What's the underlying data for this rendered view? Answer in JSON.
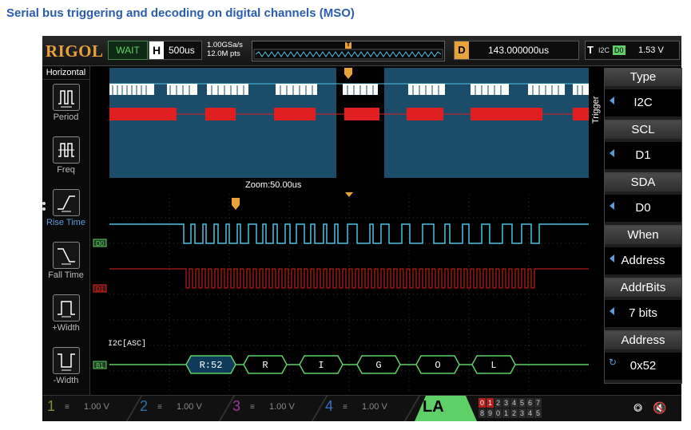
{
  "page": {
    "title": "Serial bus triggering and decoding on digital channels (MSO)"
  },
  "topbar": {
    "logo": "RIGOL",
    "status": "WAIT",
    "horizontal": {
      "key": "H",
      "value": "500us"
    },
    "sample_rate": "1.00GSa/s",
    "memory_depth": "12.0M pts",
    "trigger_marker": "T",
    "delay": {
      "key": "D",
      "value": "143.000000us"
    },
    "trigger": {
      "key": "T",
      "type": "I2C",
      "source": "D0",
      "level": "1.53 V"
    }
  },
  "leftbar": {
    "title": "Horizontal",
    "items": [
      {
        "label": "Period",
        "icon": "period-icon"
      },
      {
        "label": "Freq",
        "icon": "frequency-icon"
      },
      {
        "label": "Rise Time",
        "icon": "rise-time-icon"
      },
      {
        "label": "Fall Time",
        "icon": "fall-time-icon"
      },
      {
        "label": "+Width",
        "icon": "positive-width-icon"
      },
      {
        "label": "-Width",
        "icon": "negative-width-icon"
      }
    ]
  },
  "waveform": {
    "zoom_label": "Zoom:50.00us",
    "channel_labels": {
      "d0": "D0",
      "d1": "D1",
      "bus": "B1"
    },
    "bus_label": "I2C[ASC]",
    "decode_packets": [
      "R:52",
      "R",
      "I",
      "G",
      "O",
      "L"
    ]
  },
  "rightbar": {
    "tab": "Trigger",
    "items": [
      {
        "name": "Type",
        "value": "I2C"
      },
      {
        "name": "SCL",
        "value": "D1"
      },
      {
        "name": "SDA",
        "value": "D0"
      },
      {
        "name": "When",
        "value": "Address"
      },
      {
        "name": "AddrBits",
        "value": "7 bits"
      },
      {
        "name": "Address",
        "value": "0x52"
      }
    ]
  },
  "bottombar": {
    "channels": [
      {
        "num": "1",
        "volt": "1.00 V",
        "color": "#8a8a3a"
      },
      {
        "num": "2",
        "volt": "1.00 V",
        "color": "#2f6fa8"
      },
      {
        "num": "3",
        "volt": "1.00 V",
        "color": "#9a3a9a"
      },
      {
        "num": "4",
        "volt": "1.00 V",
        "color": "#3a6fc8"
      }
    ],
    "la": {
      "label": "LA",
      "row1": [
        "0",
        "1",
        "2",
        "3",
        "4",
        "5",
        "6",
        "7"
      ],
      "row2": [
        "8",
        "9",
        "0",
        "1",
        "2",
        "3",
        "4",
        "5"
      ]
    }
  },
  "colors": {
    "cyan_trace": "#4fc3e0",
    "red_trace": "#e02020",
    "green_bus": "#5fd067",
    "accent_orange": "#e8a23a",
    "overview_bg": "#1b4d6b"
  }
}
